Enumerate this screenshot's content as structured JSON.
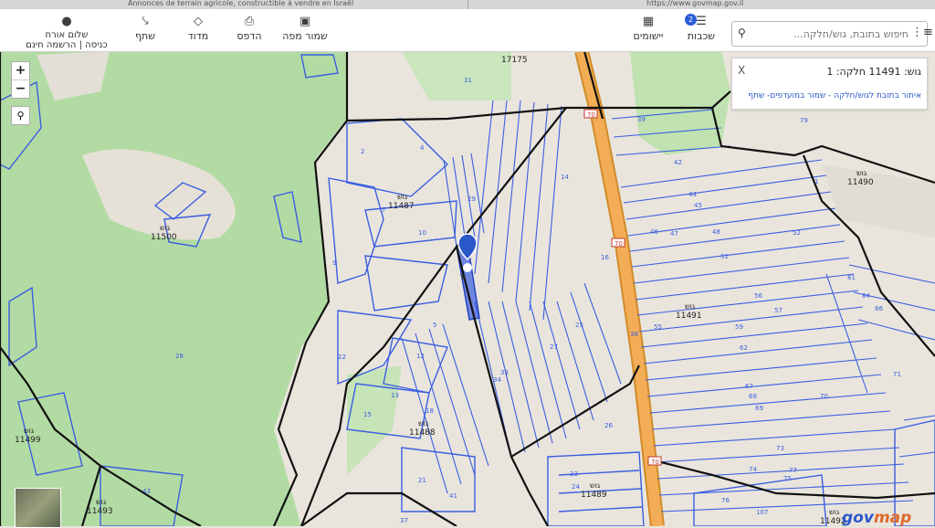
{
  "browser": {
    "tab_left": "Annonces de terrain agricole, constructible à vendre en Israël",
    "tab_right": "https://www.govmap.gov.il"
  },
  "toolbar": {
    "user_greeting": "שלום אורח",
    "user_login": "כניסה | הרשמה חינם",
    "share": "שתף",
    "measure": "מדוד",
    "print": "הדפס",
    "save_map": "שמור מפה",
    "apps": "יישומים",
    "layers": "שכבות",
    "layers_badge": "2"
  },
  "search": {
    "placeholder": "חיפוש בתובת, גוש/חלקה..."
  },
  "result_panel": {
    "title": "גוש: 11491 חלקה: 1",
    "close": "X",
    "links": "איתור בתובת לגוש/חלקה - שמור במועדפים- שתף"
  },
  "map": {
    "zoom_in": "+",
    "zoom_out": "−",
    "road_shield": "70",
    "blocks": [
      {
        "label": "גוש",
        "number": "11487"
      },
      {
        "label": "גוש",
        "number": "11500"
      },
      {
        "label": "גוש",
        "number": "11490"
      },
      {
        "label": "גוש",
        "number": "11491"
      },
      {
        "label": "גוש",
        "number": "11488"
      },
      {
        "label": "גוש",
        "number": "11499"
      },
      {
        "label": "גוש",
        "number": "11489"
      },
      {
        "label": "גוש",
        "number": "11493"
      },
      {
        "label": "גוש",
        "number": "11492"
      }
    ],
    "top_label": "17175",
    "parcels": [
      "31",
      "2",
      "4",
      "7",
      "10",
      "9",
      "22",
      "5",
      "12",
      "13",
      "18",
      "15",
      "21",
      "41",
      "43",
      "37",
      "28",
      "29",
      "14",
      "16",
      "25",
      "27",
      "33",
      "34",
      "38",
      "39",
      "42",
      "44",
      "45",
      "46",
      "47",
      "48",
      "51",
      "52",
      "56",
      "57",
      "55",
      "59",
      "62",
      "67",
      "68",
      "69",
      "70",
      "71",
      "73",
      "74",
      "75",
      "76",
      "77",
      "81",
      "84",
      "86",
      "26",
      "23",
      "24",
      "107",
      "79",
      "1"
    ]
  },
  "logo": {
    "gov": "gov",
    "map": "map"
  },
  "colors": {
    "parcel": "#3a5ee0",
    "block": "#111111",
    "green": "#a7d498",
    "highway": "#f0a948"
  }
}
